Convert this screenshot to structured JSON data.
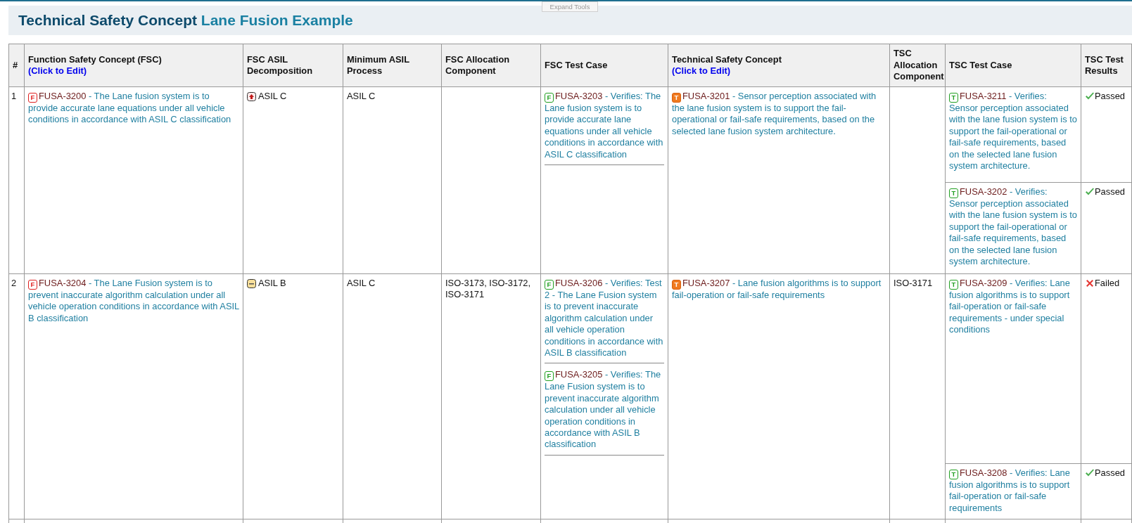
{
  "title": {
    "main": "Technical Safety Concept",
    "sub": "Lane Fusion Example"
  },
  "expand_tools": "Expand Tools",
  "table": {
    "columns": [
      {
        "label": "#"
      },
      {
        "label": "Function Safety Concept (FSC)",
        "link": "(Click to Edit)"
      },
      {
        "label": "FSC ASIL Decomposition"
      },
      {
        "label": "Minimum ASIL Process"
      },
      {
        "label": "FSC Allocation Component"
      },
      {
        "label": "FSC Test Case"
      },
      {
        "label": "Technical Safety Concept",
        "link": "(Click to Edit)"
      },
      {
        "label": "TSC Allocation Component"
      },
      {
        "label": "TSC Test Case"
      },
      {
        "label": "TSC Test Results"
      }
    ],
    "rows": [
      {
        "number": "1",
        "fsc": {
          "kind": "requirement",
          "badge": "F",
          "id": "FUSA-3200",
          "text": "- The Lane fusion system is to provide accurate lane equations under all vehicle conditions in accordance with ASIL C classification"
        },
        "asil": {
          "kind": "raise",
          "label": "ASIL C"
        },
        "min_asil": "ASIL C",
        "fsc_tests": [
          {
            "kind": "test",
            "badge": "F",
            "id": "FUSA-3203",
            "text": "- Verifies: The Lane fusion system is to provide accurate lane equations under all vehicle conditions in accordance with ASIL C classification"
          }
        ],
        "tsc": {
          "kind": "technical",
          "badge": "T",
          "id": "FUSA-3201",
          "text": "- Sensor perception associated with the lane fusion system is to support the fail-operational or fail-safe requirements, based on the selected lane fusion system architecture."
        },
        "tsc_tests": [
          {
            "kind": "test",
            "badge": "T",
            "id": "FUSA-3211",
            "text": "- Verifies: Sensor perception associated with the lane fusion system is to support the fail-operational or fail-safe requirements, based on the selected lane fusion system architecture.",
            "result": {
              "kind": "passed",
              "label": "Passed"
            }
          },
          {
            "kind": "test",
            "badge": "T",
            "id": "FUSA-3202",
            "text": "- Verifies: Sensor perception associated with the lane fusion system is to support the fail-operational or fail-safe requirements, based on the selected lane fusion system architecture.",
            "result": {
              "kind": "passed",
              "label": "Passed"
            }
          }
        ]
      },
      {
        "number": "2",
        "fsc": {
          "kind": "requirement",
          "badge": "F",
          "id": "FUSA-3204",
          "text": "- The Lane Fusion system is to prevent inaccurate algorithm calculation under all vehicle operation conditions in accordance with ASIL B classification"
        },
        "asil": {
          "kind": "equal",
          "label": "ASIL B"
        },
        "min_asil": "ASIL C",
        "allocation": "ISO-3173, ISO-3172, ISO-3171",
        "fsc_tests": [
          {
            "kind": "test",
            "badge": "F",
            "id": "FUSA-3206",
            "text": "- Verifies: Test 2 - The Lane Fusion system is to prevent inaccurate algorithm calculation under all vehicle operation conditions in accordance with ASIL B classification"
          },
          {
            "kind": "test",
            "badge": "F",
            "id": "FUSA-3205",
            "text": "- Verifies: The Lane Fusion system is to prevent inaccurate algorithm calculation under all vehicle operation conditions in accordance with ASIL B classification"
          }
        ],
        "tsc": {
          "kind": "technical",
          "badge": "T",
          "id": "FUSA-3207",
          "text": "- Lane fusion algorithms is to support fail-operation or fail-safe requirements"
        },
        "tsc_allocation": "ISO-3171",
        "tsc_tests": [
          {
            "kind": "test",
            "badge": "T",
            "id": "FUSA-3209",
            "text": "- Verifies: Lane fusion algorithms is to support fail-operation or fail-safe requirements - under special conditions",
            "result": {
              "kind": "failed",
              "label": "Failed"
            }
          },
          {
            "kind": "test",
            "badge": "T",
            "id": "FUSA-3208",
            "text": "- Verifies: Lane fusion algorithms is to support fail-operation or fail-safe requirements",
            "result": {
              "kind": "passed",
              "label": "Passed"
            }
          }
        ]
      }
    ]
  }
}
